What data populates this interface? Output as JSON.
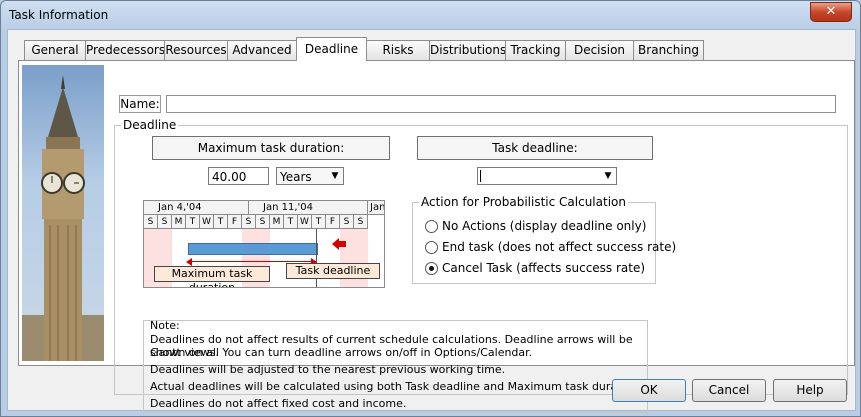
{
  "window": {
    "title": "Task Information",
    "close_glyph": "✕"
  },
  "tabs": [
    {
      "label": "General"
    },
    {
      "label": "Predecessors"
    },
    {
      "label": "Resources"
    },
    {
      "label": "Advanced"
    },
    {
      "label": "Deadline",
      "active": true
    },
    {
      "label": "Risks"
    },
    {
      "label": "Distributions"
    },
    {
      "label": "Tracking"
    },
    {
      "label": "Decision"
    },
    {
      "label": "Branching"
    }
  ],
  "name": {
    "label": "Name:",
    "value": ""
  },
  "deadline": {
    "group_label": "Deadline",
    "max_duration_label": "Maximum task duration:",
    "max_duration_value": "40.00",
    "unit_value": "Years",
    "task_deadline_label": "Task deadline:",
    "task_deadline_value": ""
  },
  "gantt": {
    "weeks": [
      "Jan 4,'04",
      "Jan 11,'04",
      "Jan"
    ],
    "days": [
      "S",
      "S",
      "M",
      "T",
      "W",
      "T",
      "F",
      "S",
      "S",
      "M",
      "T",
      "W",
      "T",
      "F",
      "S",
      "S"
    ],
    "label_max": "Maximum task duration",
    "label_deadline": "Task deadline",
    "bar_color": "#5b9bd5",
    "arrow_color": "#d40000"
  },
  "action": {
    "group_label": "Action for Probabilistic Calculation",
    "options": [
      {
        "label": "No Actions (display deadline only)",
        "selected": false
      },
      {
        "label": "End task (does not affect success rate)",
        "selected": false
      },
      {
        "label": "Cancel Task (affects success rate)",
        "selected": true
      }
    ]
  },
  "note": {
    "label": "Note:",
    "lines": [
      "Deadlines do not affect results of current schedule calculations. Deadline arrows will be shown on all",
      "Gantt views. You can turn deadline arrows on/off in Options/Calendar.",
      "Deadlines will be adjusted to the nearest previous working time.",
      "Actual deadlines will be calculated using both Task deadline and Maximum task duration.",
      "Deadlines do not affect fixed cost and income."
    ]
  },
  "buttons": {
    "ok": "OK",
    "cancel": "Cancel",
    "help": "Help"
  }
}
